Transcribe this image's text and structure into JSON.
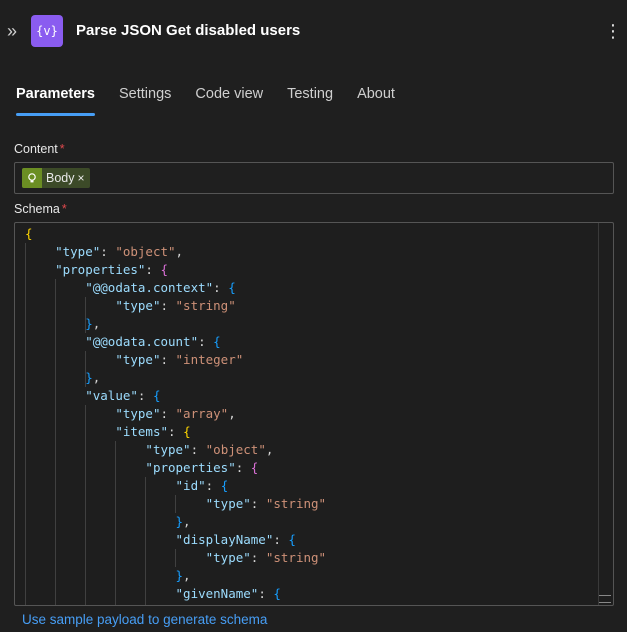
{
  "header": {
    "collapse_icon": "chevron-double-right",
    "action_icon": "braces-variable",
    "action_icon_text": "{v}",
    "title": "Parse JSON Get disabled users",
    "more_icon": "more-vertical"
  },
  "tabs": [
    {
      "label": "Parameters",
      "active": true
    },
    {
      "label": "Settings",
      "active": false
    },
    {
      "label": "Code view",
      "active": false
    },
    {
      "label": "Testing",
      "active": false
    },
    {
      "label": "About",
      "active": false
    }
  ],
  "content": {
    "label": "Content",
    "required_mark": "*",
    "token": {
      "label": "Body",
      "icon": "lightbulb",
      "remove": "×"
    }
  },
  "schema": {
    "label": "Schema",
    "required_mark": "*",
    "lines": [
      [
        {
          "t": "{",
          "c": "p1"
        }
      ],
      [
        {
          "t": "    "
        },
        {
          "t": "\"type\"",
          "c": "k"
        },
        {
          "t": ": ",
          "c": "w"
        },
        {
          "t": "\"object\"",
          "c": "s"
        },
        {
          "t": ",",
          "c": "w"
        }
      ],
      [
        {
          "t": "    "
        },
        {
          "t": "\"properties\"",
          "c": "k"
        },
        {
          "t": ": ",
          "c": "w"
        },
        {
          "t": "{",
          "c": "p2"
        }
      ],
      [
        {
          "t": "        "
        },
        {
          "t": "\"@@odata.context\"",
          "c": "k"
        },
        {
          "t": ": ",
          "c": "w"
        },
        {
          "t": "{",
          "c": "p3"
        }
      ],
      [
        {
          "t": "            "
        },
        {
          "t": "\"type\"",
          "c": "k"
        },
        {
          "t": ": ",
          "c": "w"
        },
        {
          "t": "\"string\"",
          "c": "s"
        }
      ],
      [
        {
          "t": "        "
        },
        {
          "t": "}",
          "c": "p3"
        },
        {
          "t": ",",
          "c": "w"
        }
      ],
      [
        {
          "t": "        "
        },
        {
          "t": "\"@@odata.count\"",
          "c": "k"
        },
        {
          "t": ": ",
          "c": "w"
        },
        {
          "t": "{",
          "c": "p3"
        }
      ],
      [
        {
          "t": "            "
        },
        {
          "t": "\"type\"",
          "c": "k"
        },
        {
          "t": ": ",
          "c": "w"
        },
        {
          "t": "\"integer\"",
          "c": "s"
        }
      ],
      [
        {
          "t": "        "
        },
        {
          "t": "}",
          "c": "p3"
        },
        {
          "t": ",",
          "c": "w"
        }
      ],
      [
        {
          "t": "        "
        },
        {
          "t": "\"value\"",
          "c": "k"
        },
        {
          "t": ": ",
          "c": "w"
        },
        {
          "t": "{",
          "c": "p3"
        }
      ],
      [
        {
          "t": "            "
        },
        {
          "t": "\"type\"",
          "c": "k"
        },
        {
          "t": ": ",
          "c": "w"
        },
        {
          "t": "\"array\"",
          "c": "s"
        },
        {
          "t": ",",
          "c": "w"
        }
      ],
      [
        {
          "t": "            "
        },
        {
          "t": "\"items\"",
          "c": "k"
        },
        {
          "t": ": ",
          "c": "w"
        },
        {
          "t": "{",
          "c": "p1"
        }
      ],
      [
        {
          "t": "                "
        },
        {
          "t": "\"type\"",
          "c": "k"
        },
        {
          "t": ": ",
          "c": "w"
        },
        {
          "t": "\"object\"",
          "c": "s"
        },
        {
          "t": ",",
          "c": "w"
        }
      ],
      [
        {
          "t": "                "
        },
        {
          "t": "\"properties\"",
          "c": "k"
        },
        {
          "t": ": ",
          "c": "w"
        },
        {
          "t": "{",
          "c": "p2"
        }
      ],
      [
        {
          "t": "                    "
        },
        {
          "t": "\"id\"",
          "c": "k"
        },
        {
          "t": ": ",
          "c": "w"
        },
        {
          "t": "{",
          "c": "p3"
        }
      ],
      [
        {
          "t": "                        "
        },
        {
          "t": "\"type\"",
          "c": "k"
        },
        {
          "t": ": ",
          "c": "w"
        },
        {
          "t": "\"string\"",
          "c": "s"
        }
      ],
      [
        {
          "t": "                    "
        },
        {
          "t": "}",
          "c": "p3"
        },
        {
          "t": ",",
          "c": "w"
        }
      ],
      [
        {
          "t": "                    "
        },
        {
          "t": "\"displayName\"",
          "c": "k"
        },
        {
          "t": ": ",
          "c": "w"
        },
        {
          "t": "{",
          "c": "p3"
        }
      ],
      [
        {
          "t": "                        "
        },
        {
          "t": "\"type\"",
          "c": "k"
        },
        {
          "t": ": ",
          "c": "w"
        },
        {
          "t": "\"string\"",
          "c": "s"
        }
      ],
      [
        {
          "t": "                    "
        },
        {
          "t": "}",
          "c": "p3"
        },
        {
          "t": ",",
          "c": "w"
        }
      ],
      [
        {
          "t": "                    "
        },
        {
          "t": "\"givenName\"",
          "c": "k"
        },
        {
          "t": ": ",
          "c": "w"
        },
        {
          "t": "{",
          "c": "p3"
        }
      ]
    ]
  },
  "footer": {
    "link": "Use sample payload to generate schema"
  },
  "colors": {
    "accent": "#479ef5",
    "action_icon_bg": "#8a5cf0",
    "required": "#e0494d",
    "token_bg": "#3c4a28"
  }
}
